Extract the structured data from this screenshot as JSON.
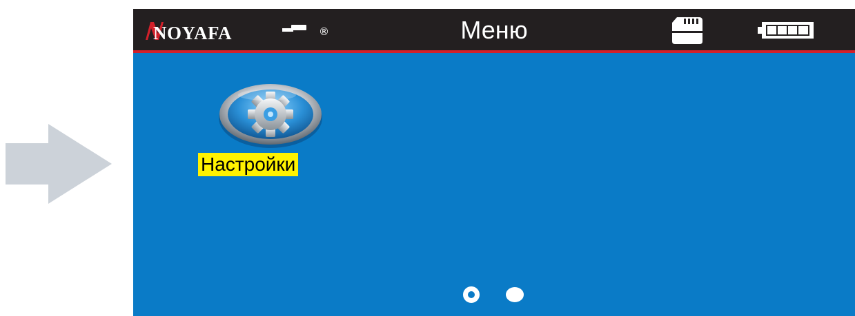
{
  "header": {
    "brand": "NOYAFA",
    "registered_mark": "®",
    "title": "Меню"
  },
  "status": {
    "storage_icon": "sd-card-icon",
    "battery_icon": "battery-full-icon",
    "battery_level": 1.0
  },
  "menu": {
    "items": [
      {
        "label": "Настройки",
        "icon": "gear-icon",
        "selected": true
      }
    ]
  },
  "pager": {
    "pages": 2,
    "current": 1
  },
  "colors": {
    "screen_bg": "#0a7bc7",
    "topbar_bg": "#231f20",
    "topbar_accent": "#d3202a",
    "selection_highlight": "#fff200",
    "nav_arrow": "#ccd2d9"
  }
}
